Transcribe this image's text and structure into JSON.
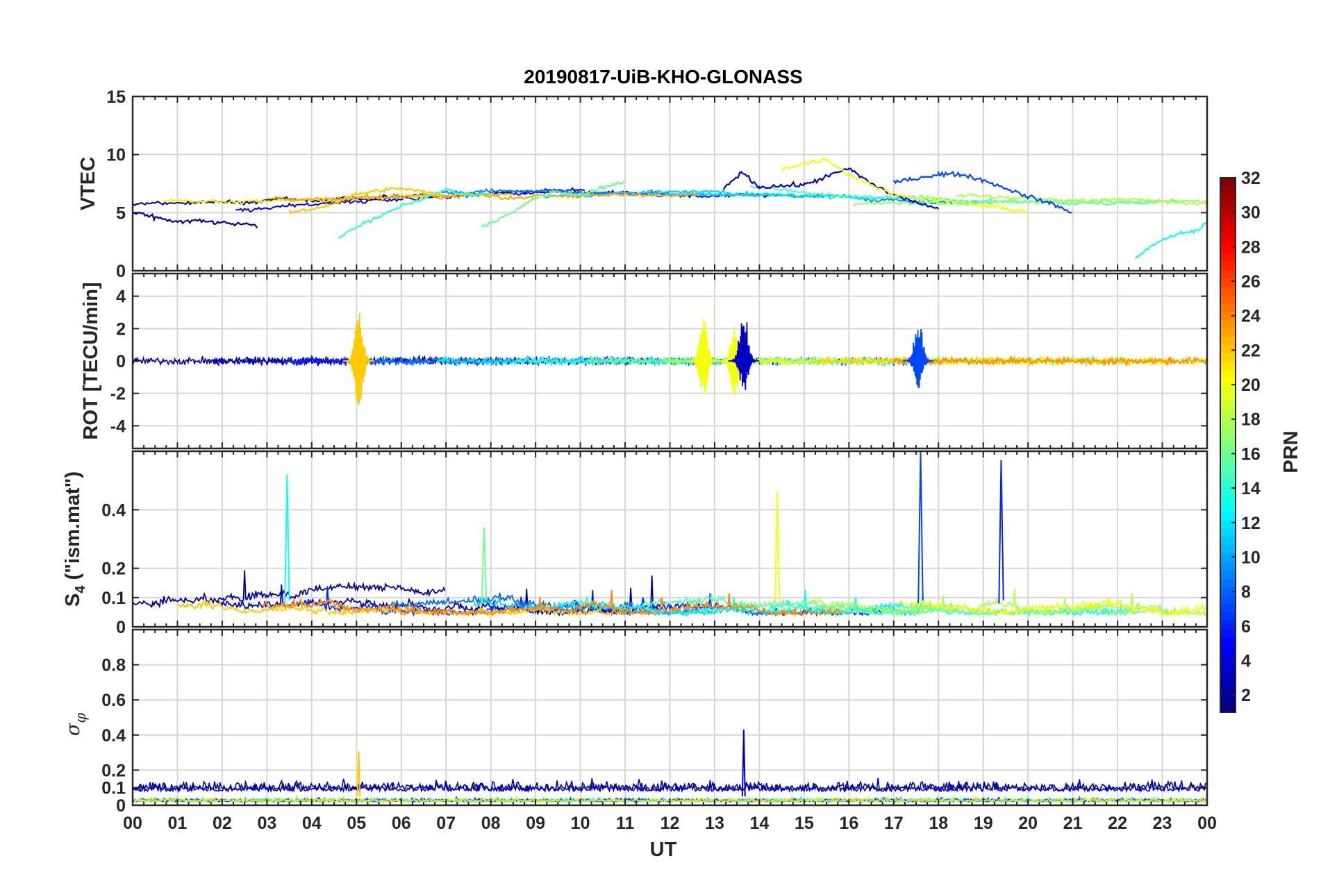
{
  "chart_data": {
    "type": "line",
    "title": "20190817-UiB-KHO-GLONASS",
    "shared_x": {
      "label": "UT",
      "range": [
        0,
        24
      ],
      "tick_labels": [
        "00",
        "01",
        "02",
        "03",
        "04",
        "05",
        "06",
        "07",
        "08",
        "09",
        "10",
        "11",
        "12",
        "13",
        "14",
        "15",
        "16",
        "17",
        "18",
        "19",
        "20",
        "21",
        "22",
        "23",
        "00"
      ]
    },
    "grid": true,
    "colorbar": {
      "label": "PRN",
      "range": [
        1,
        32
      ],
      "tick_labels": [
        "2",
        "4",
        "6",
        "8",
        "10",
        "12",
        "14",
        "16",
        "18",
        "20",
        "22",
        "24",
        "26",
        "28",
        "30",
        "32"
      ],
      "colormap": "jet",
      "placement": "right"
    },
    "panels": [
      {
        "name": "vtec",
        "ylabel": "VTEC",
        "ylim": [
          0,
          15
        ],
        "yticks": [
          "0",
          "5",
          "10",
          "15"
        ],
        "series": [
          {
            "prn": 2,
            "x": [
              0,
              0.5,
              1,
              1.5,
              2,
              2.5,
              2.8
            ],
            "y": [
              5.0,
              4.6,
              4.2,
              4.3,
              4.1,
              4.0,
              3.8
            ]
          },
          {
            "prn": 3,
            "x": [
              13.2,
              13.6,
              14,
              15,
              16,
              16.5,
              17,
              18
            ],
            "y": [
              7.0,
              8.5,
              7.2,
              7.4,
              8.8,
              7.5,
              6.5,
              5.3
            ]
          },
          {
            "prn": 7,
            "x": [
              17,
              18,
              18.5,
              19,
              20,
              20.5,
              21
            ],
            "y": [
              7.6,
              8.3,
              8.3,
              7.8,
              6.4,
              5.8,
              5.0
            ]
          },
          {
            "prn": 13,
            "x": [
              22.4,
              22.8,
              23.3,
              23.8,
              24
            ],
            "y": [
              1.0,
              2.3,
              3.1,
              3.5,
              4.2
            ]
          },
          {
            "prn": 14,
            "x": [
              4.6,
              5,
              5.5,
              6,
              6.5,
              7,
              7.5,
              8
            ],
            "y": [
              2.8,
              3.8,
              4.6,
              5.6,
              6.2,
              7.0,
              6.5,
              6.7
            ]
          },
          {
            "prn": 16,
            "x": [
              7.8,
              8.5,
              9,
              9.5,
              10,
              10.5,
              11
            ],
            "y": [
              3.8,
              5.0,
              6.3,
              6.8,
              6.5,
              7.2,
              7.6
            ]
          },
          {
            "prn": 22,
            "x": [
              3.5,
              4,
              4.5,
              5,
              5.5,
              6,
              6.5,
              7
            ],
            "y": [
              5.0,
              5.3,
              5.8,
              6.6,
              6.9,
              7.1,
              6.8,
              6.4
            ]
          },
          {
            "prn": 20,
            "x": [
              14.5,
              15,
              15.5,
              16,
              16.5,
              17,
              18,
              19,
              20
            ],
            "y": [
              8.8,
              9.2,
              9.6,
              8.3,
              7.4,
              6.5,
              6.1,
              5.6,
              5.1
            ]
          }
        ]
      },
      {
        "name": "rot",
        "ylabel": "ROT [TECU/min]",
        "ylim": [
          -5.4,
          5.4
        ],
        "yticks": [
          "-4",
          "-2",
          "0",
          "2",
          "4"
        ],
        "events": [
          {
            "prn": 22,
            "x": 5.05,
            "max": 3.3,
            "min": -3.2
          },
          {
            "prn": 20,
            "x": 12.75,
            "max": 2.7,
            "min": -2.3
          },
          {
            "prn": 20,
            "x": 13.45,
            "max": 2.2,
            "min": -2.3
          },
          {
            "prn": 3,
            "x": 13.65,
            "max": 3.4,
            "min": -2.0
          },
          {
            "prn": 7,
            "x": 17.55,
            "max": 2.8,
            "min": -1.7
          }
        ]
      },
      {
        "name": "s4",
        "ylabel": "S4 (\"ism.mat\")",
        "ylabel_main": "S",
        "ylabel_sub": "4",
        "ylabel_rest": " (\"ism.mat\")",
        "ylim": [
          0,
          0.6
        ],
        "yticks": [
          "0",
          "0.1",
          "0.2",
          "0.4"
        ],
        "spikes": [
          {
            "prn": 13,
            "x": 3.45,
            "y": 0.52
          },
          {
            "prn": 7,
            "x": 17.6,
            "y": 0.6
          },
          {
            "prn": 6,
            "x": 19.4,
            "y": 0.57
          },
          {
            "prn": 20,
            "x": 14.4,
            "y": 0.46
          },
          {
            "prn": 16,
            "x": 7.85,
            "y": 0.34
          }
        ]
      },
      {
        "name": "sigma_phi",
        "ylabel": "σφ",
        "ylabel_main": "σ",
        "ylabel_sub": "φ",
        "ylim": [
          0,
          1.0
        ],
        "yticks": [
          "0",
          "0.1",
          "0.2",
          "0.4",
          "0.6",
          "0.8"
        ],
        "spikes": [
          {
            "prn": 3,
            "x": 13.65,
            "y": 0.43
          },
          {
            "prn": 22,
            "x": 5.05,
            "y": 0.31
          }
        ]
      }
    ]
  }
}
